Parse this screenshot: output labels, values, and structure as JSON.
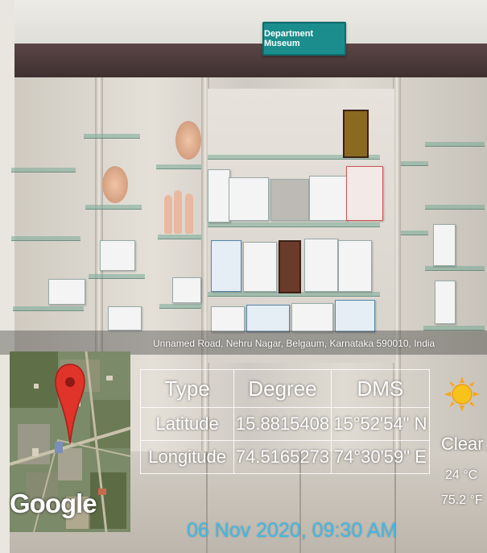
{
  "photo": {
    "sign_text": "Department Museum"
  },
  "location": {
    "address": "Unnamed Road, Nehru Nagar, Belgaum, Karnataka 590010, India"
  },
  "map": {
    "provider_logo": "Google",
    "marker_icon": "map-pin-icon",
    "marker_color": "#e0332a"
  },
  "coordinates": {
    "headers": [
      "Type",
      "Degree",
      "DMS"
    ],
    "rows": [
      {
        "type": "Latitude",
        "degree": "15.8815408",
        "dms": "15°52'54\" N"
      },
      {
        "type": "Longitude",
        "degree": "74.5165273",
        "dms": "74°30'59\" E"
      }
    ]
  },
  "weather": {
    "icon": "sun-icon",
    "condition": "Clear",
    "temp_c": "24 °C",
    "temp_f": "75.2 °F"
  },
  "timestamp": {
    "text": "06 Nov 2020, 09:30 AM",
    "color": "#3fb8e6"
  }
}
